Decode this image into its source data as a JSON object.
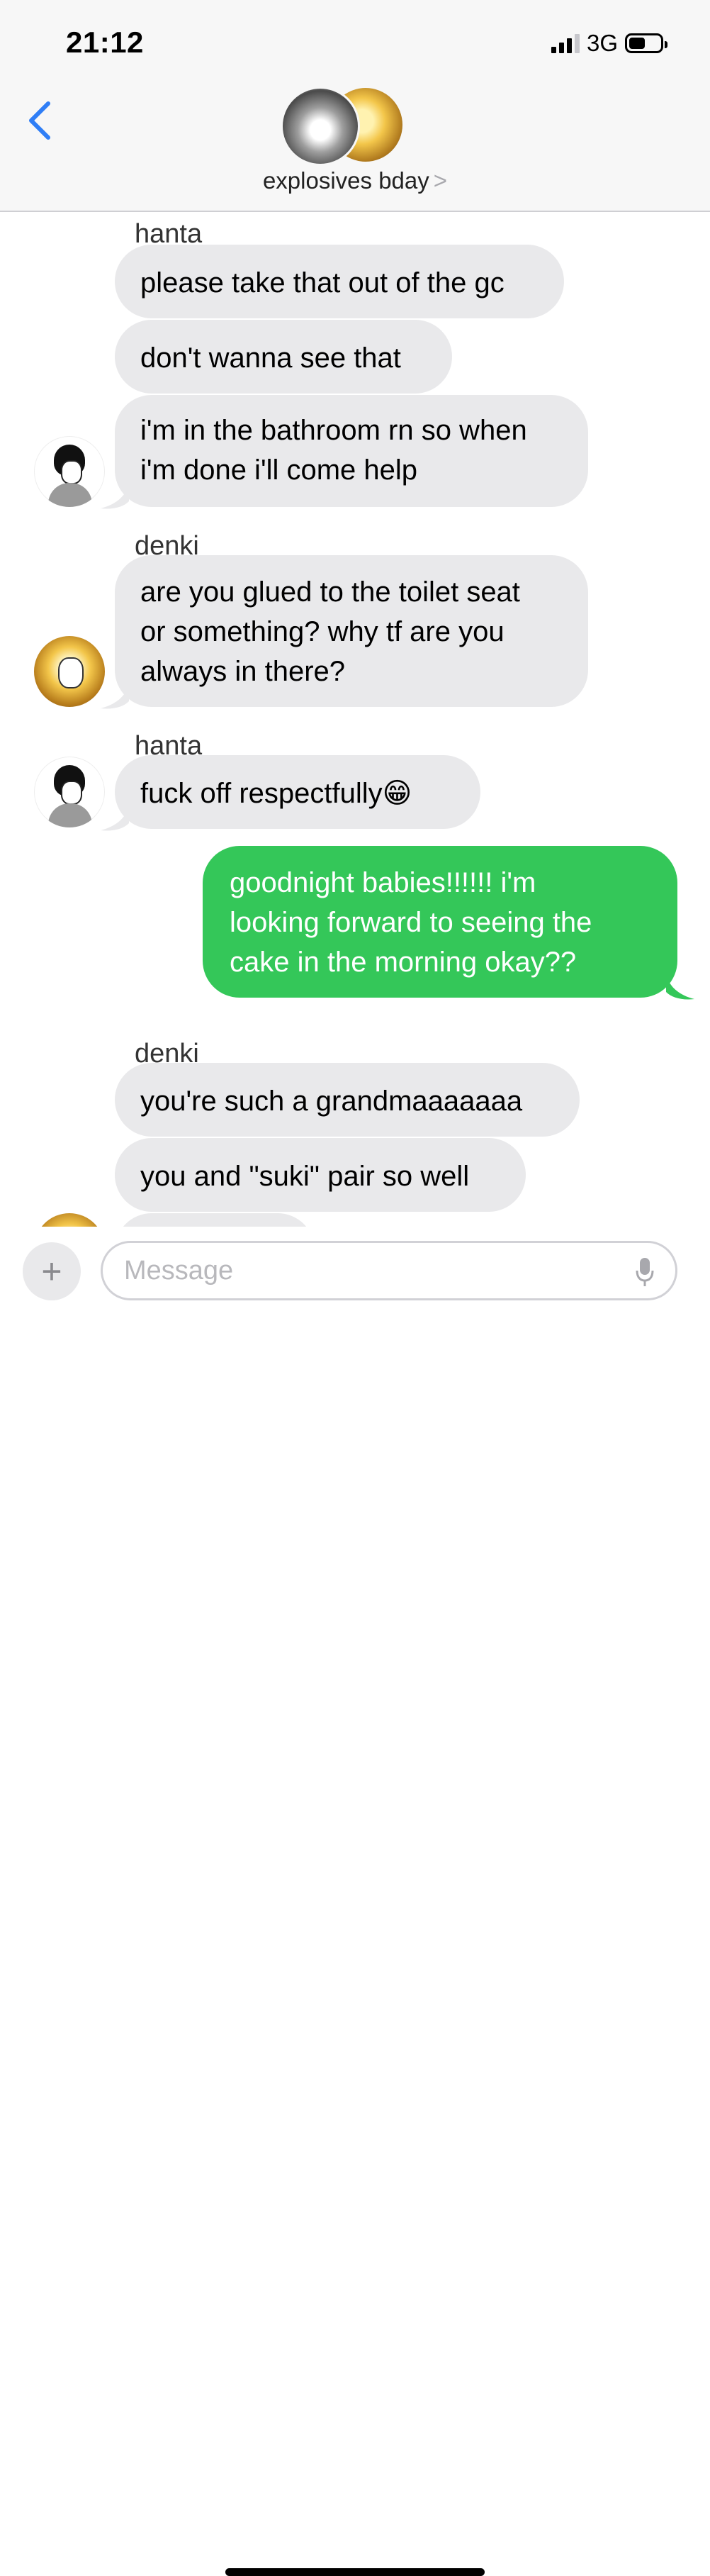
{
  "status_bar": {
    "time": "21:12",
    "network": "3G",
    "signal_bars": 3,
    "battery_level": 0.45
  },
  "header": {
    "back_icon": "chevron-left-icon",
    "group_name": "explosives bday",
    "group_chevron": ">",
    "accent": "#2f7ef6"
  },
  "messages": [
    {
      "sender": "hanta",
      "text": "please take that out of the gc"
    },
    {
      "text": "don't wanna see that"
    },
    {
      "lines": [
        "i'm in the bathroom rn so when",
        "i'm done i'll come help"
      ]
    },
    {
      "sender": "denki",
      "lines": [
        "are you glued to the toilet seat",
        "or something? why tf are you",
        "always in there?"
      ]
    },
    {
      "sender": "hanta",
      "text": "fuck off respectfully😁"
    },
    {
      "outgoing": true,
      "lines": [
        "goodnight babies!!!!!! i'm",
        "looking forward to seeing the",
        "cake in the morning okay??"
      ]
    },
    {
      "sender": "denki",
      "text": "you're such a grandmaaaaaaa"
    },
    {
      "text": "you and \"suki\" pair so well"
    }
  ],
  "composer": {
    "add_icon": "+",
    "placeholder": "Message",
    "mic_icon": "microphone-icon"
  },
  "colors": {
    "incoming_bubble": "#e9e9eb",
    "outgoing_bubble": "#34c759",
    "header_bg": "#f7f7f7"
  }
}
